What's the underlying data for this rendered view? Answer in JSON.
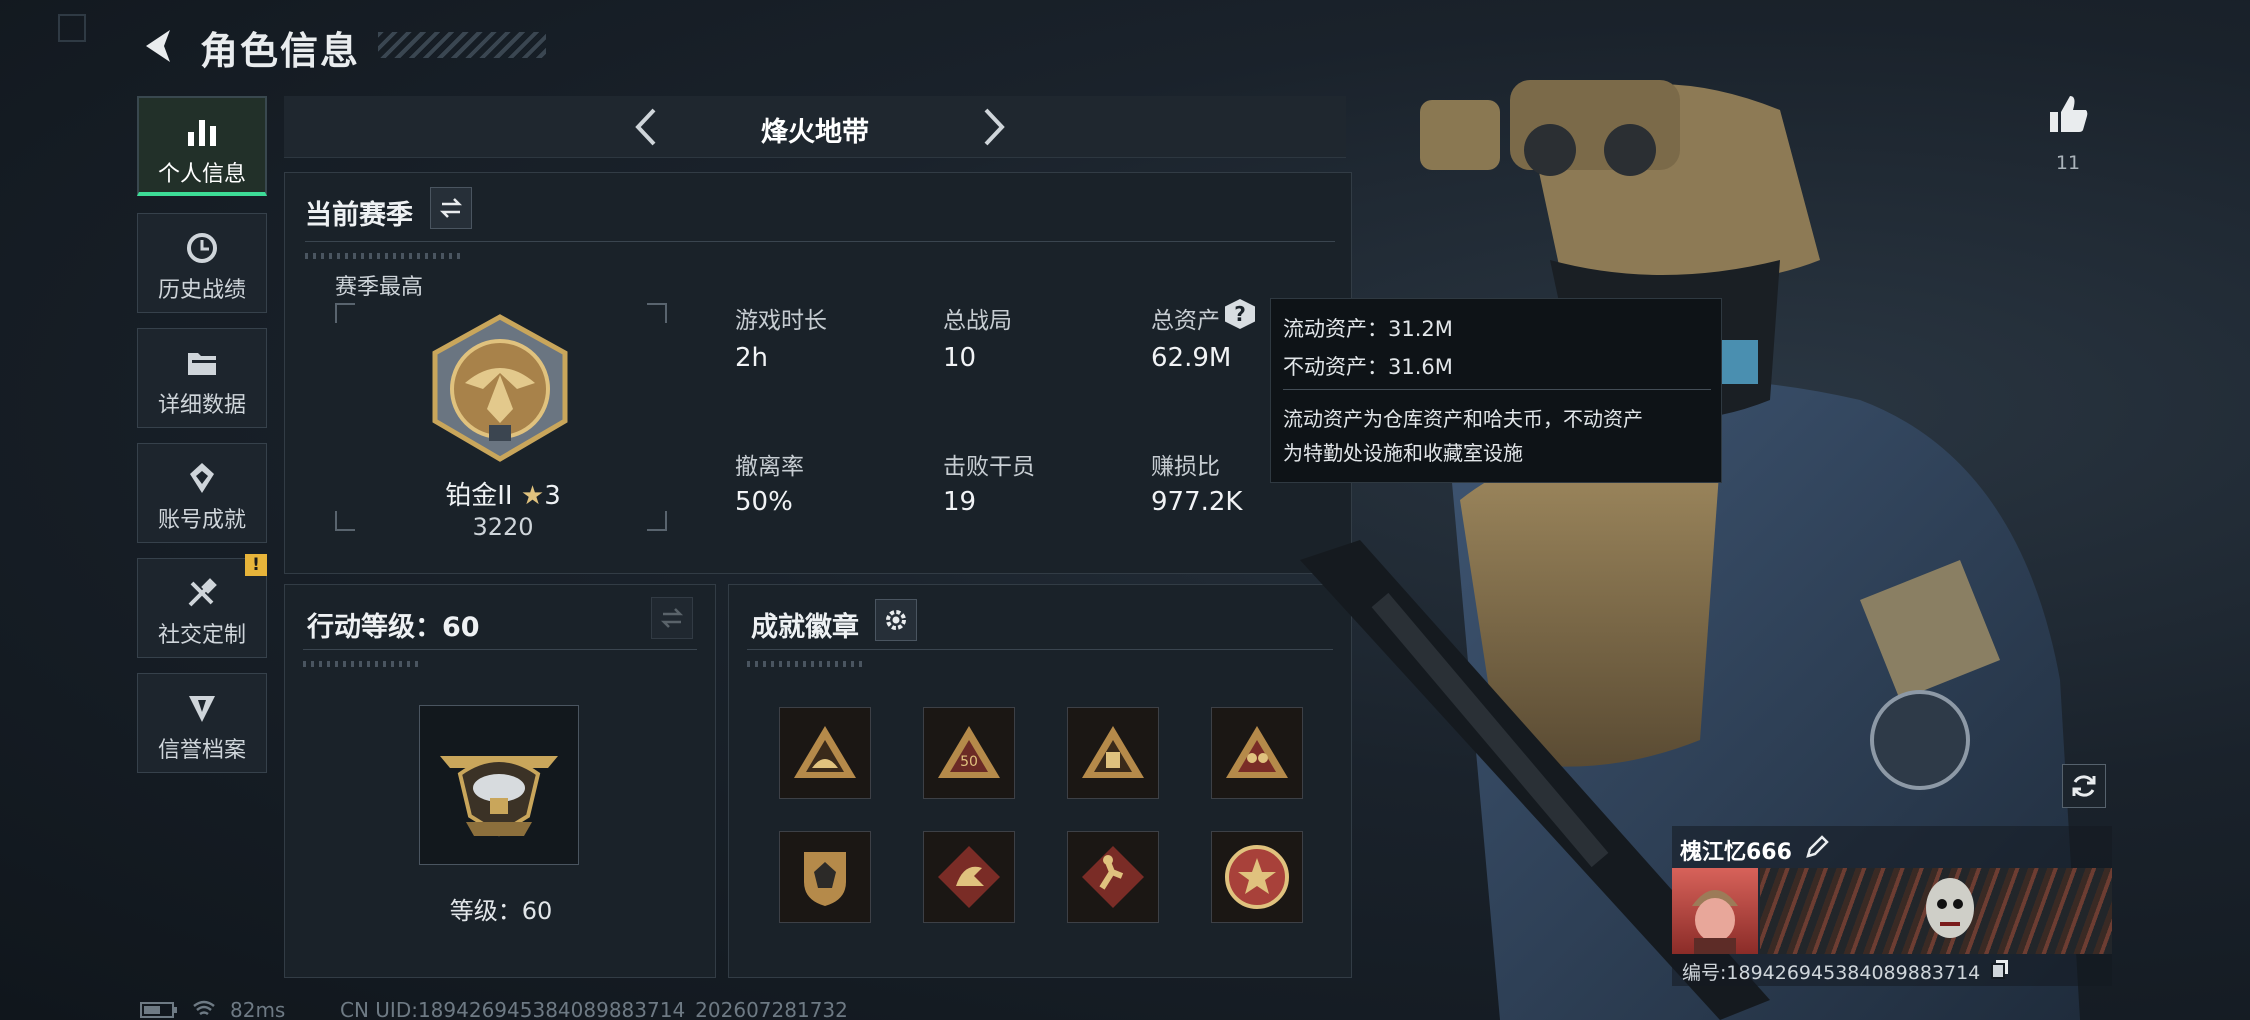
{
  "header": {
    "title": "角色信息"
  },
  "sidebar": {
    "items": [
      {
        "label": "个人信息",
        "icon": "bar-chart-icon",
        "active": true
      },
      {
        "label": "历史战绩",
        "icon": "history-icon"
      },
      {
        "label": "详细数据",
        "icon": "folder-icon"
      },
      {
        "label": "账号成就",
        "icon": "achievement-icon"
      },
      {
        "label": "社交定制",
        "icon": "tools-icon",
        "badge": "!"
      },
      {
        "label": "信誉档案",
        "icon": "shield-icon"
      }
    ]
  },
  "mode": {
    "name": "烽火地带"
  },
  "season": {
    "title": "当前赛季",
    "best_label": "赛季最高",
    "rank_name": "铂金II",
    "rank_stars": "3",
    "rank_score": "3220",
    "stats": [
      {
        "label": "游戏时长",
        "value": "2h"
      },
      {
        "label": "总战局",
        "value": "10"
      },
      {
        "label": "总资产",
        "value": "62.9M"
      },
      {
        "label": "撤离率",
        "value": "50%"
      },
      {
        "label": "击败干员",
        "value": "19"
      },
      {
        "label": "赚损比",
        "value": "977.2K"
      }
    ]
  },
  "tooltip": {
    "liquid": "流动资产：31.2M",
    "fixed": "不动资产：31.6M",
    "desc1": "流动资产为仓库资产和哈夫币，不动资产",
    "desc2": "为特勤处设施和收藏室设施"
  },
  "action_level": {
    "title": "行动等级：60",
    "level_text": "等级：60"
  },
  "achievements": {
    "title": "成就徽章"
  },
  "likes": {
    "count": "11"
  },
  "player": {
    "name": "槐江忆666",
    "id": "编号:18942694538408988371​4"
  },
  "status_bar": {
    "ping": "82ms",
    "uid": "CN UID:18942694538408988371​4_202607281732"
  },
  "colors": {
    "accent": "#3ddc97",
    "warning": "#e7b43a",
    "gold": "#c9a65b"
  }
}
